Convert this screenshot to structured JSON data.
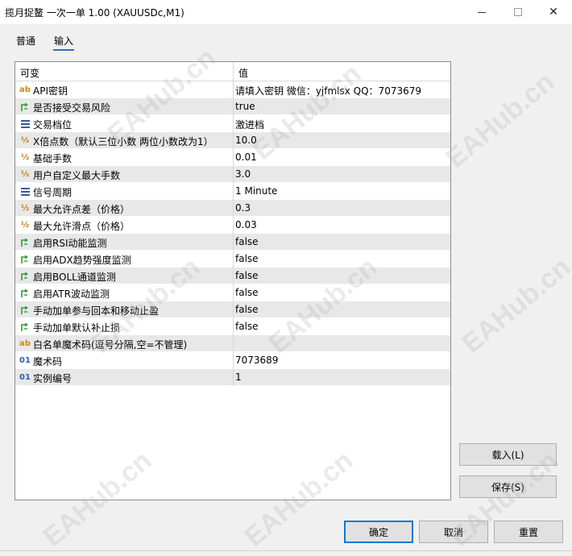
{
  "window": {
    "title": "揽月捉鳌 一次一单 1.00 (XAUUSDc,M1)",
    "minimize_glyph": "—",
    "maximize_glyph": "☐",
    "close_glyph": "✕"
  },
  "tabs": [
    {
      "label": "普通",
      "active": false
    },
    {
      "label": "输入",
      "active": true
    }
  ],
  "grid": {
    "header_variable": "可变",
    "header_value": "值",
    "rows": [
      {
        "icon": "ab",
        "icon_name": "string-type-icon",
        "name": "API密钥",
        "value": "请填入密钥 微信：yjfmlsx QQ：7073679"
      },
      {
        "icon": "bool",
        "icon_name": "bool-type-icon",
        "name": "是否接受交易风险",
        "value": "true"
      },
      {
        "icon": "enum",
        "icon_name": "enum-type-icon",
        "name": "交易档位",
        "value": "激进档"
      },
      {
        "icon": "½",
        "icon_name": "double-type-icon",
        "name": "X倍点数（默认三位小数 两位小数改为1）",
        "value": "10.0"
      },
      {
        "icon": "½",
        "icon_name": "double-type-icon",
        "name": "基础手数",
        "value": "0.01"
      },
      {
        "icon": "½",
        "icon_name": "double-type-icon",
        "name": "用户自定义最大手数",
        "value": "3.0"
      },
      {
        "icon": "enum",
        "icon_name": "enum-type-icon",
        "name": "信号周期",
        "value": "1 Minute"
      },
      {
        "icon": "½",
        "icon_name": "double-type-icon",
        "name": "最大允许点差（价格）",
        "value": "0.3"
      },
      {
        "icon": "½",
        "icon_name": "double-type-icon",
        "name": "最大允许滑点（价格）",
        "value": "0.03"
      },
      {
        "icon": "bool",
        "icon_name": "bool-type-icon",
        "name": "启用RSI动能监测",
        "value": "false"
      },
      {
        "icon": "bool",
        "icon_name": "bool-type-icon",
        "name": "启用ADX趋势强度监测",
        "value": "false"
      },
      {
        "icon": "bool",
        "icon_name": "bool-type-icon",
        "name": "启用BOLL通道监测",
        "value": "false"
      },
      {
        "icon": "bool",
        "icon_name": "bool-type-icon",
        "name": "启用ATR波动监测",
        "value": "false"
      },
      {
        "icon": "bool",
        "icon_name": "bool-type-icon",
        "name": "手动加单参与回本和移动止盈",
        "value": "false"
      },
      {
        "icon": "bool",
        "icon_name": "bool-type-icon",
        "name": "手动加单默认补止损",
        "value": "false"
      },
      {
        "icon": "ab",
        "icon_name": "string-type-icon",
        "name": "白名单魔术码(逗号分隔,空=不管理)",
        "value": ""
      },
      {
        "icon": "01",
        "icon_name": "int-type-icon",
        "name": "魔术码",
        "value": "7073689"
      },
      {
        "icon": "01",
        "icon_name": "int-type-icon",
        "name": "实例编号",
        "value": "1"
      }
    ]
  },
  "buttons": {
    "load": "载入(L)",
    "save": "保存(S)",
    "ok": "确定",
    "cancel": "取消",
    "reset": "重置"
  },
  "watermark_text": "EAHub.cn",
  "colors": {
    "tab_underline": "#2a6ec4",
    "ok_button_border": "#0078d7",
    "string_icon": "#c88a1a",
    "double_icon": "#c07a12",
    "int_icon": "#2a5fb8",
    "bool_icon": "#2e9e2e"
  }
}
